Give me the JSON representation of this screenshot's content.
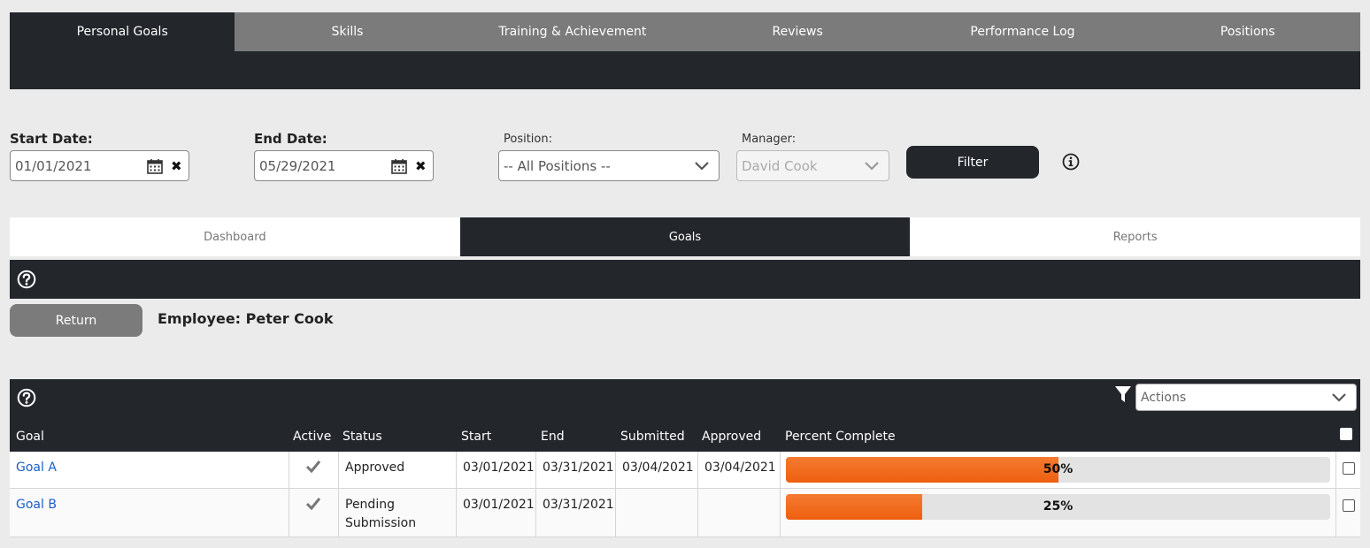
{
  "top_tabs": [
    "Personal Goals",
    "Skills",
    "Training & Achievement",
    "Reviews",
    "Performance Log",
    "Positions"
  ],
  "filters": {
    "start_label": "Start Date:",
    "start_value": "01/01/2021",
    "end_label": "End Date:",
    "end_value": "05/29/2021",
    "position_label": "Position:",
    "position_value": "-- All Positions --",
    "manager_label": "Manager:",
    "manager_value": "David Cook",
    "filter_button": "Filter"
  },
  "sub_tabs": [
    "Dashboard",
    "Goals",
    "Reports"
  ],
  "return_button": "Return",
  "employee": "Employee: Peter Cook",
  "grid": {
    "actions_placeholder": "Actions",
    "columns": [
      "Goal",
      "Active",
      "Status",
      "Start",
      "End",
      "Submitted",
      "Approved",
      "Percent Complete"
    ],
    "rows": [
      {
        "goal": "Goal A",
        "active": true,
        "status": "Approved",
        "start": "03/01/2021",
        "end": "03/31/2021",
        "submitted": "03/04/2021",
        "approved": "03/04/2021",
        "percent": 50,
        "percent_label": "50%"
      },
      {
        "goal": "Goal B",
        "active": true,
        "status": "Pending Submission",
        "start": "03/01/2021",
        "end": "03/31/2021",
        "submitted": "",
        "approved": "",
        "percent": 25,
        "percent_label": "25%"
      }
    ]
  },
  "colors": {
    "dark": "#23262b",
    "tab_gray": "#7b7b7b",
    "progress_orange": "#ee5f10",
    "link_blue": "#1a5fc9"
  }
}
